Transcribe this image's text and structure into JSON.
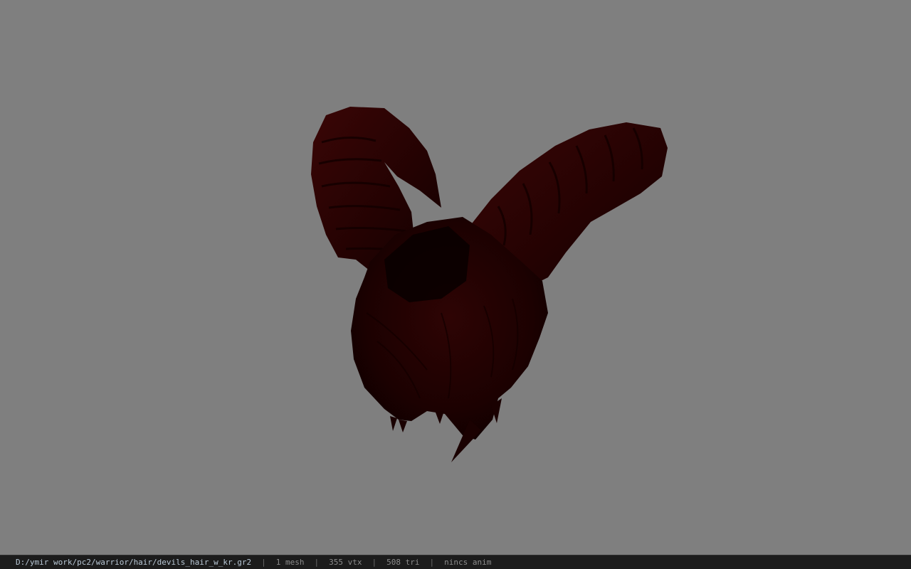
{
  "viewer": {
    "background_color": "#7f7f7f",
    "model_color": "#2a0303",
    "model": "devils-hair-horns-model"
  },
  "status_bar": {
    "file_path": "D:/ymir work/pc2/warrior/hair/devils_hair_w_kr.gr2",
    "separator": "|",
    "mesh_count": "1 mesh",
    "vertex_count": "355 vtx",
    "triangle_count": "508 tri",
    "anim_status": "nincs anim"
  }
}
